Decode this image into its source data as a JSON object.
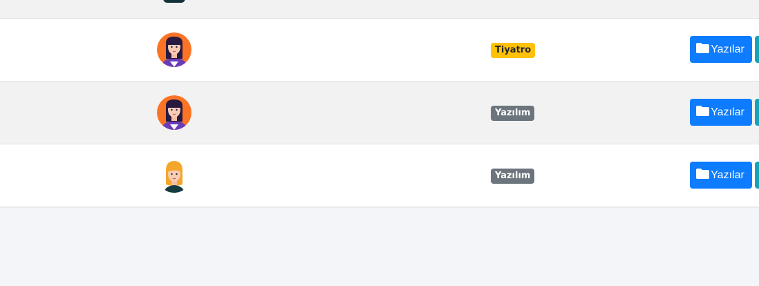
{
  "rows": [
    {
      "avatar": "woman-purple-hair-avatar",
      "category": "Tiyatro",
      "category_color": "#ffc107",
      "posts_button": "Yazılar"
    },
    {
      "avatar": "woman-purple-hair-avatar",
      "category": "Yazılım",
      "category_color": "#6c757d",
      "posts_button": "Yazılar"
    },
    {
      "avatar": "woman-blonde-hair-avatar",
      "category": "Yazılım",
      "category_color": "#6c757d",
      "posts_button": "Yazılar"
    }
  ],
  "icons": {
    "posts_button_icon": "folder-icon"
  },
  "colors": {
    "primary": "#0d7cff",
    "info": "#17a2b8",
    "warning": "#ffc107",
    "secondary": "#6c757d"
  }
}
